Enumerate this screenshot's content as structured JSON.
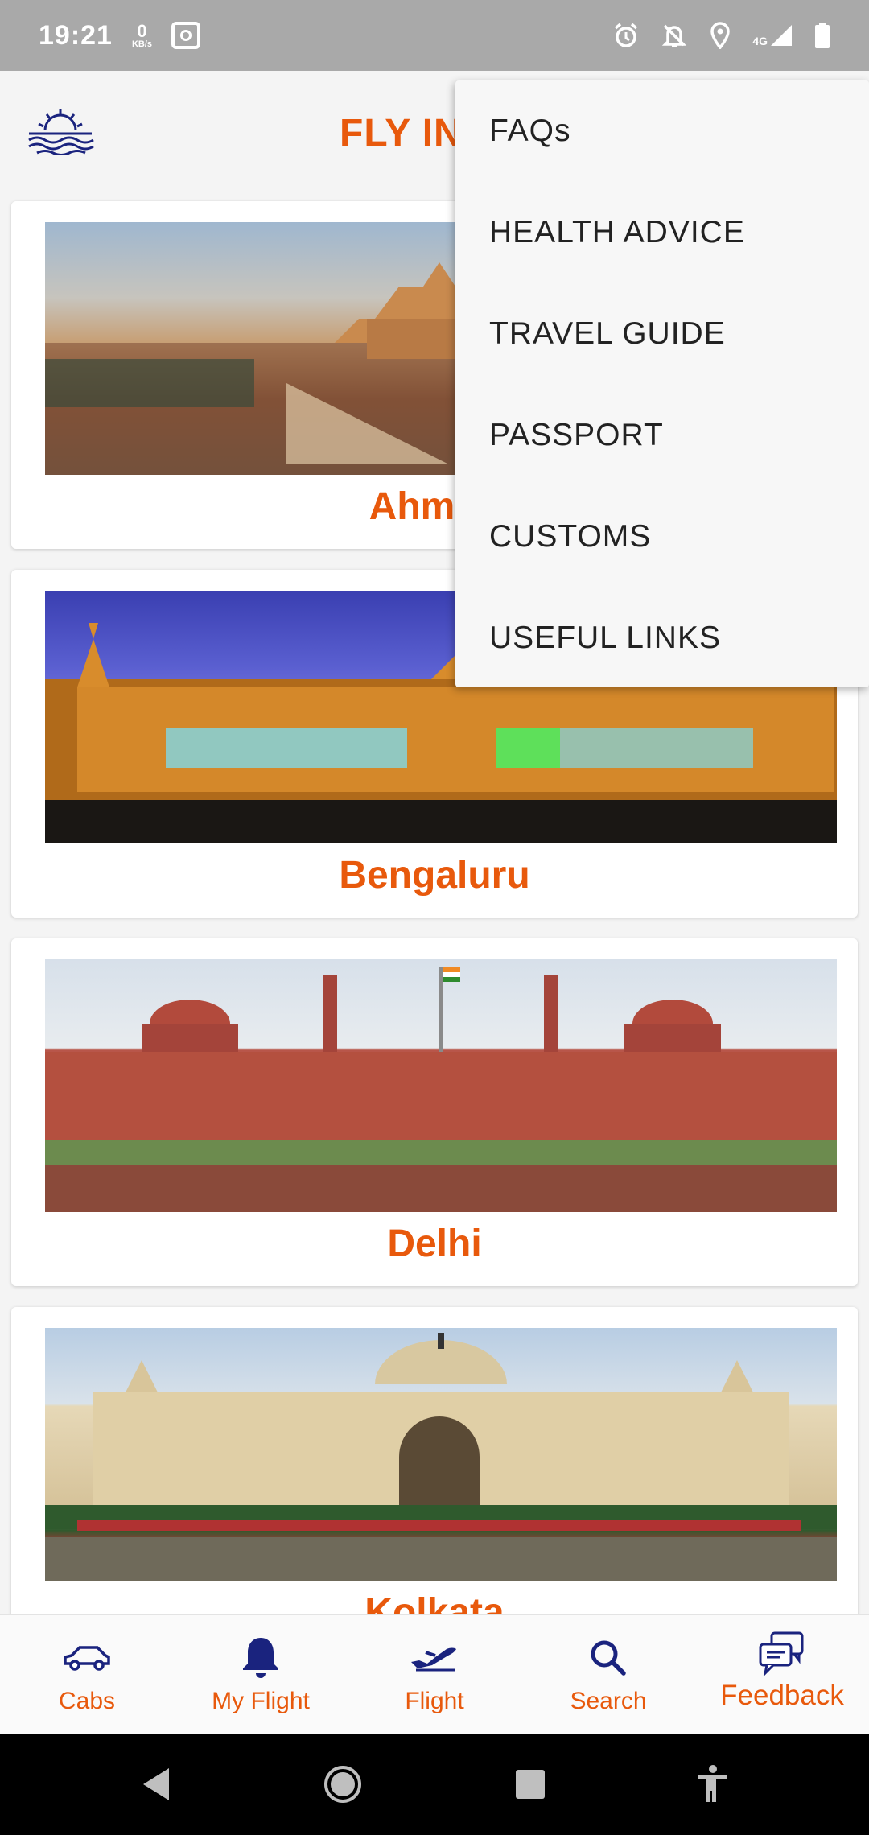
{
  "status_bar": {
    "time": "19:21",
    "net_speed_value": "0",
    "net_speed_unit": "KB/s",
    "signal_label": "4G"
  },
  "header": {
    "title": "FLY IN"
  },
  "cities": [
    {
      "name": "Ahmed"
    },
    {
      "name": "Bengaluru"
    },
    {
      "name": "Delhi"
    },
    {
      "name": "Kolkata"
    }
  ],
  "menu": {
    "items": [
      {
        "label": "FAQs"
      },
      {
        "label": "HEALTH ADVICE"
      },
      {
        "label": "TRAVEL GUIDE"
      },
      {
        "label": "PASSPORT"
      },
      {
        "label": "CUSTOMS"
      },
      {
        "label": "USEFUL LINKS"
      }
    ]
  },
  "bottom_nav": {
    "items": [
      {
        "label": "Cabs",
        "icon": "car-icon"
      },
      {
        "label": "My Flight",
        "icon": "bell-icon"
      },
      {
        "label": "Flight",
        "icon": "plane-icon"
      },
      {
        "label": "Search",
        "icon": "search-icon"
      },
      {
        "label": "Feedback",
        "icon": "feedback-icon"
      }
    ]
  },
  "colors": {
    "accent": "#e8590c",
    "icon_navy": "#1a237e"
  }
}
